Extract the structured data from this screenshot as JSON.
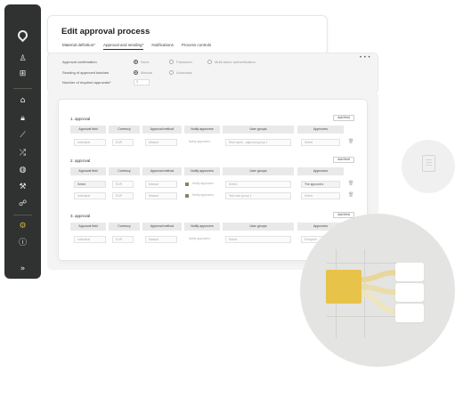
{
  "page": {
    "title": "Edit approval process",
    "tabs": [
      "Material definition*",
      "Approval and sending*",
      "Notifications",
      "Process controls"
    ]
  },
  "settings": {
    "approval_confirmation_label": "Approval confirmation",
    "approval_options": [
      "None",
      "Password",
      "Multi-factor authentication"
    ],
    "sending_label": "Sending of approved batches",
    "sending_options": [
      "Manual",
      "Automatic"
    ],
    "required_label": "Number of required approvals*",
    "required_value": "3",
    "more_label": "• • •"
  },
  "approvals": {
    "add_label": "Add field",
    "columns": [
      "Approval field",
      "Currency",
      "Approval method",
      "Notify approvers",
      "User groups",
      "Approvers"
    ],
    "sections": [
      {
        "title": "1. approval",
        "rows": [
          [
            "Individual",
            "EUR",
            "Manual",
            "Notify approvers",
            "Real name - approval group 1",
            "Select"
          ]
        ]
      },
      {
        "title": "2. approval",
        "rows": [
          [
            "Select",
            "EUR",
            "Manual",
            "Notify approvers",
            "Select",
            "The approvers"
          ],
          [
            "Individual",
            "EUR",
            "Manual",
            "Notify approvers",
            "Test user group 1",
            "Select"
          ]
        ]
      },
      {
        "title": "3. approval",
        "rows": [
          [
            "Individual",
            "EUR",
            "Manual",
            "Notify approvers",
            "Select",
            "Everyone"
          ]
        ]
      }
    ]
  },
  "sidebar": {
    "icons": [
      "logo-icon",
      "user-icon",
      "grid-icon",
      "home-icon",
      "lock-icon",
      "chart-icon",
      "shuffle-icon",
      "globe-icon",
      "wrench-icon",
      "link-icon",
      "gear-icon",
      "info-icon",
      "expand-icon"
    ]
  },
  "colors": {
    "sidebar": "#2f3230",
    "accent": "#d9b43a",
    "yellow": "#e8c34a"
  }
}
